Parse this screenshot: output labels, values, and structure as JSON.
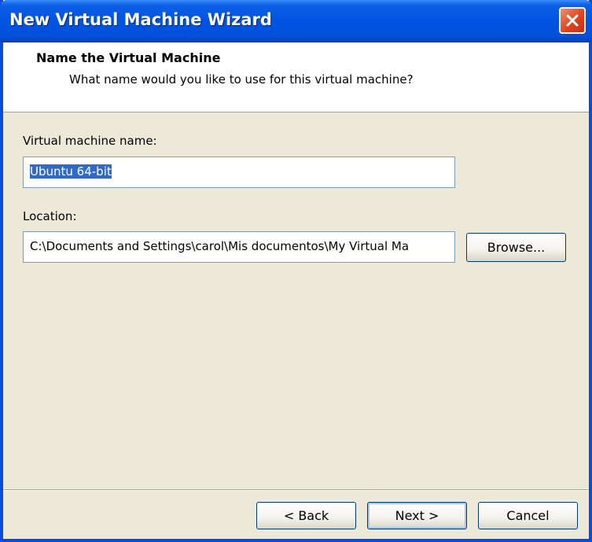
{
  "window": {
    "title": "New Virtual Machine Wizard",
    "close_icon": "close-icon"
  },
  "header": {
    "title": "Name the Virtual Machine",
    "subtitle": "What name would you like to use for this virtual machine?"
  },
  "form": {
    "vm_name_label": "Virtual machine name:",
    "vm_name_value": "Ubuntu 64-bit",
    "location_label": "Location:",
    "location_value": "C:\\Documents and Settings\\carol\\Mis documentos\\My Virtual Ma",
    "browse_label": "Browse..."
  },
  "footer": {
    "back_label": "< Back",
    "next_label": "Next >",
    "cancel_label": "Cancel"
  }
}
